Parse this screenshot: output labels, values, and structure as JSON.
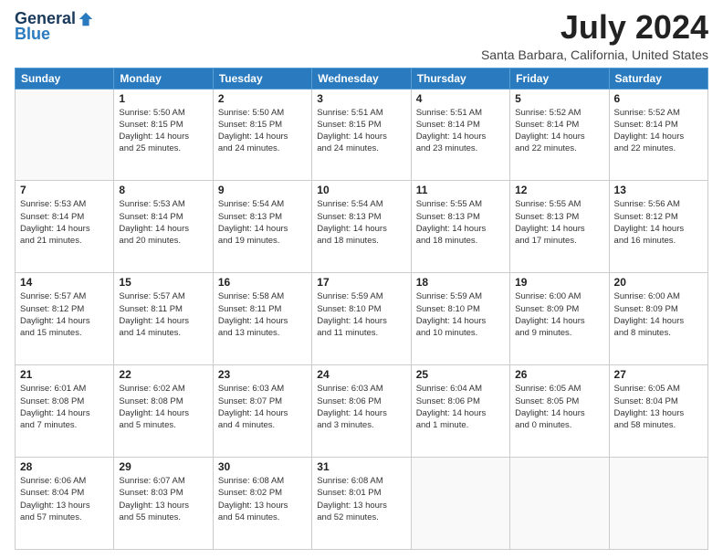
{
  "logo": {
    "general": "General",
    "blue": "Blue"
  },
  "header": {
    "month": "July 2024",
    "location": "Santa Barbara, California, United States"
  },
  "weekdays": [
    "Sunday",
    "Monday",
    "Tuesday",
    "Wednesday",
    "Thursday",
    "Friday",
    "Saturday"
  ],
  "weeks": [
    [
      {
        "day": "",
        "info": ""
      },
      {
        "day": "1",
        "info": "Sunrise: 5:50 AM\nSunset: 8:15 PM\nDaylight: 14 hours\nand 25 minutes."
      },
      {
        "day": "2",
        "info": "Sunrise: 5:50 AM\nSunset: 8:15 PM\nDaylight: 14 hours\nand 24 minutes."
      },
      {
        "day": "3",
        "info": "Sunrise: 5:51 AM\nSunset: 8:15 PM\nDaylight: 14 hours\nand 24 minutes."
      },
      {
        "day": "4",
        "info": "Sunrise: 5:51 AM\nSunset: 8:14 PM\nDaylight: 14 hours\nand 23 minutes."
      },
      {
        "day": "5",
        "info": "Sunrise: 5:52 AM\nSunset: 8:14 PM\nDaylight: 14 hours\nand 22 minutes."
      },
      {
        "day": "6",
        "info": "Sunrise: 5:52 AM\nSunset: 8:14 PM\nDaylight: 14 hours\nand 22 minutes."
      }
    ],
    [
      {
        "day": "7",
        "info": "Sunrise: 5:53 AM\nSunset: 8:14 PM\nDaylight: 14 hours\nand 21 minutes."
      },
      {
        "day": "8",
        "info": "Sunrise: 5:53 AM\nSunset: 8:14 PM\nDaylight: 14 hours\nand 20 minutes."
      },
      {
        "day": "9",
        "info": "Sunrise: 5:54 AM\nSunset: 8:13 PM\nDaylight: 14 hours\nand 19 minutes."
      },
      {
        "day": "10",
        "info": "Sunrise: 5:54 AM\nSunset: 8:13 PM\nDaylight: 14 hours\nand 18 minutes."
      },
      {
        "day": "11",
        "info": "Sunrise: 5:55 AM\nSunset: 8:13 PM\nDaylight: 14 hours\nand 18 minutes."
      },
      {
        "day": "12",
        "info": "Sunrise: 5:55 AM\nSunset: 8:13 PM\nDaylight: 14 hours\nand 17 minutes."
      },
      {
        "day": "13",
        "info": "Sunrise: 5:56 AM\nSunset: 8:12 PM\nDaylight: 14 hours\nand 16 minutes."
      }
    ],
    [
      {
        "day": "14",
        "info": "Sunrise: 5:57 AM\nSunset: 8:12 PM\nDaylight: 14 hours\nand 15 minutes."
      },
      {
        "day": "15",
        "info": "Sunrise: 5:57 AM\nSunset: 8:11 PM\nDaylight: 14 hours\nand 14 minutes."
      },
      {
        "day": "16",
        "info": "Sunrise: 5:58 AM\nSunset: 8:11 PM\nDaylight: 14 hours\nand 13 minutes."
      },
      {
        "day": "17",
        "info": "Sunrise: 5:59 AM\nSunset: 8:10 PM\nDaylight: 14 hours\nand 11 minutes."
      },
      {
        "day": "18",
        "info": "Sunrise: 5:59 AM\nSunset: 8:10 PM\nDaylight: 14 hours\nand 10 minutes."
      },
      {
        "day": "19",
        "info": "Sunrise: 6:00 AM\nSunset: 8:09 PM\nDaylight: 14 hours\nand 9 minutes."
      },
      {
        "day": "20",
        "info": "Sunrise: 6:00 AM\nSunset: 8:09 PM\nDaylight: 14 hours\nand 8 minutes."
      }
    ],
    [
      {
        "day": "21",
        "info": "Sunrise: 6:01 AM\nSunset: 8:08 PM\nDaylight: 14 hours\nand 7 minutes."
      },
      {
        "day": "22",
        "info": "Sunrise: 6:02 AM\nSunset: 8:08 PM\nDaylight: 14 hours\nand 5 minutes."
      },
      {
        "day": "23",
        "info": "Sunrise: 6:03 AM\nSunset: 8:07 PM\nDaylight: 14 hours\nand 4 minutes."
      },
      {
        "day": "24",
        "info": "Sunrise: 6:03 AM\nSunset: 8:06 PM\nDaylight: 14 hours\nand 3 minutes."
      },
      {
        "day": "25",
        "info": "Sunrise: 6:04 AM\nSunset: 8:06 PM\nDaylight: 14 hours\nand 1 minute."
      },
      {
        "day": "26",
        "info": "Sunrise: 6:05 AM\nSunset: 8:05 PM\nDaylight: 14 hours\nand 0 minutes."
      },
      {
        "day": "27",
        "info": "Sunrise: 6:05 AM\nSunset: 8:04 PM\nDaylight: 13 hours\nand 58 minutes."
      }
    ],
    [
      {
        "day": "28",
        "info": "Sunrise: 6:06 AM\nSunset: 8:04 PM\nDaylight: 13 hours\nand 57 minutes."
      },
      {
        "day": "29",
        "info": "Sunrise: 6:07 AM\nSunset: 8:03 PM\nDaylight: 13 hours\nand 55 minutes."
      },
      {
        "day": "30",
        "info": "Sunrise: 6:08 AM\nSunset: 8:02 PM\nDaylight: 13 hours\nand 54 minutes."
      },
      {
        "day": "31",
        "info": "Sunrise: 6:08 AM\nSunset: 8:01 PM\nDaylight: 13 hours\nand 52 minutes."
      },
      {
        "day": "",
        "info": ""
      },
      {
        "day": "",
        "info": ""
      },
      {
        "day": "",
        "info": ""
      }
    ]
  ]
}
